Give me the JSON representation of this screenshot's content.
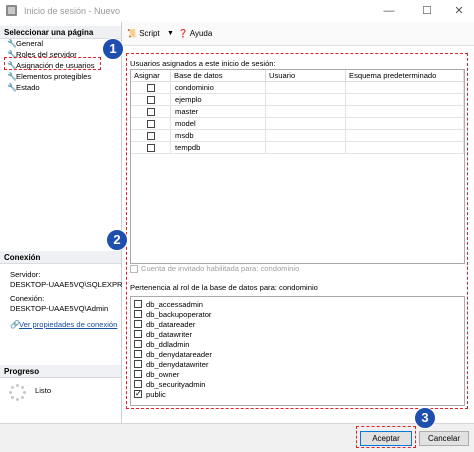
{
  "window": {
    "title": "Inicio de sesión - Nuevo"
  },
  "left_panel": {
    "select_page_heading": "Seleccionar una página",
    "pages": [
      {
        "label": "General"
      },
      {
        "label": "Roles del servidor"
      },
      {
        "label": "Asignación de usuarios"
      },
      {
        "label": "Elementos protegibles"
      },
      {
        "label": "Estado"
      }
    ],
    "connection_heading": "Conexión",
    "server_label": "Servidor:",
    "server_value": "DESKTOP-UAAE5VQ\\SQLEXPRE",
    "connection_label": "Conexión:",
    "connection_value": "DESKTOP-UAAE5VQ\\Admin",
    "view_props_link": "Ver propiedades de conexión",
    "progress_heading": "Progreso",
    "progress_status": "Listo"
  },
  "toolbar": {
    "script_label": "Script",
    "help_label": "Ayuda"
  },
  "user_mapping": {
    "group_label": "Usuarios asignados a este inicio de sesión:",
    "columns": [
      "Asignar",
      "Base de datos",
      "Usuario",
      "Esquema predeterminado"
    ],
    "rows": [
      {
        "map": false,
        "database": "condominio",
        "user": "",
        "schema": ""
      },
      {
        "map": false,
        "database": "ejemplo",
        "user": "",
        "schema": ""
      },
      {
        "map": false,
        "database": "master",
        "user": "",
        "schema": ""
      },
      {
        "map": false,
        "database": "model",
        "user": "",
        "schema": ""
      },
      {
        "map": false,
        "database": "msdb",
        "user": "",
        "schema": ""
      },
      {
        "map": false,
        "database": "tempdb",
        "user": "",
        "schema": ""
      }
    ],
    "guest_label": "Cuenta de invitado habilitada para: condominio",
    "roles_label": "Pertenencia al rol de la base de datos para: condominio",
    "roles": [
      {
        "name": "db_accessadmin",
        "checked": false
      },
      {
        "name": "db_backupoperator",
        "checked": false
      },
      {
        "name": "db_datareader",
        "checked": false
      },
      {
        "name": "db_datawriter",
        "checked": false
      },
      {
        "name": "db_ddladmin",
        "checked": false
      },
      {
        "name": "db_denydatareader",
        "checked": false
      },
      {
        "name": "db_denydatawriter",
        "checked": false
      },
      {
        "name": "db_owner",
        "checked": false
      },
      {
        "name": "db_securityadmin",
        "checked": false
      },
      {
        "name": "public",
        "checked": true
      }
    ]
  },
  "buttons": {
    "ok_label": "Aceptar",
    "cancel_label": "Cancelar"
  },
  "annotations": {
    "badge1": "1",
    "badge2": "2",
    "badge3": "3",
    "highlight_color": "#e0202a",
    "badge_color": "#1f4fae"
  }
}
